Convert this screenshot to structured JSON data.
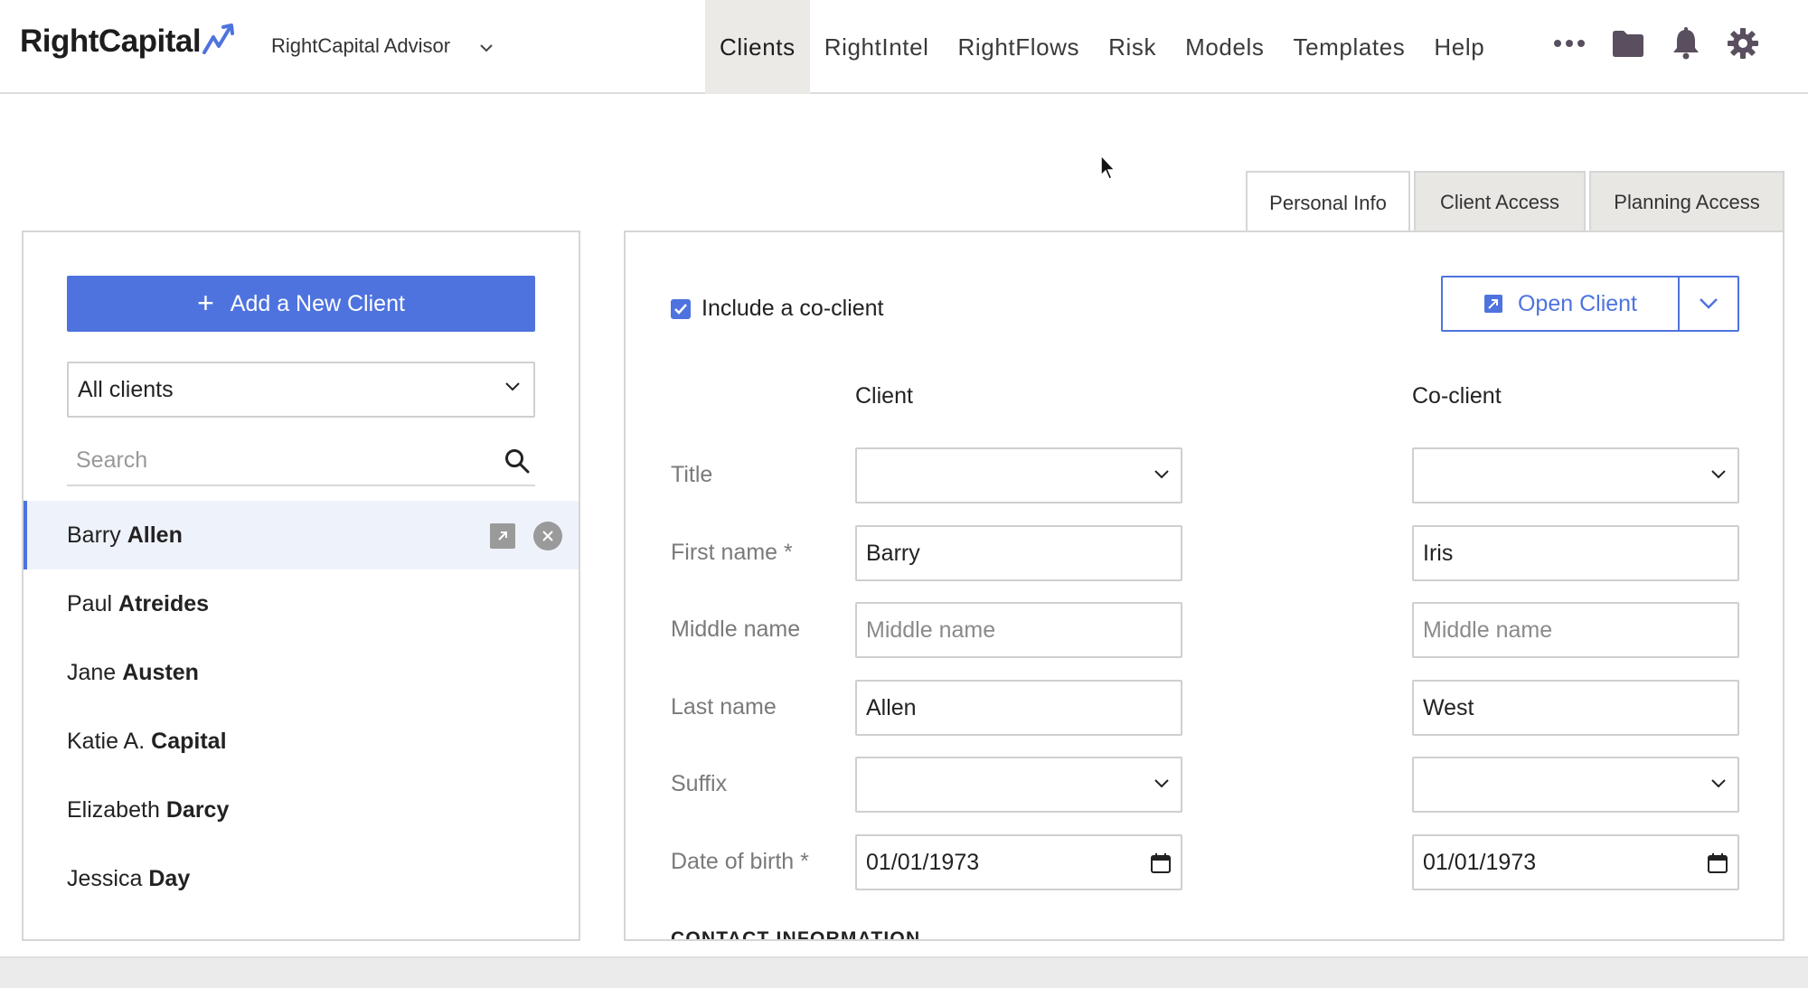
{
  "header": {
    "logo_text": "RightCapital",
    "advisor_label": "RightCapital Advisor",
    "nav": [
      {
        "label": "Clients",
        "active": true
      },
      {
        "label": "RightIntel",
        "active": false
      },
      {
        "label": "RightFlows",
        "active": false
      },
      {
        "label": "Risk",
        "active": false
      },
      {
        "label": "Models",
        "active": false
      },
      {
        "label": "Templates",
        "active": false
      },
      {
        "label": "Help",
        "active": false
      }
    ],
    "icons": [
      "more-dots-icon",
      "folder-icon",
      "bell-icon",
      "gear-icon"
    ]
  },
  "sidebar": {
    "add_button_label": "Add a New Client",
    "filter_value": "All clients",
    "search_placeholder": "Search",
    "clients": [
      {
        "first": "Barry",
        "last": "Allen",
        "selected": true
      },
      {
        "first": "Paul",
        "last": "Atreides",
        "selected": false
      },
      {
        "first": "Jane",
        "last": "Austen",
        "selected": false
      },
      {
        "first": "Katie A.",
        "last": "Capital",
        "selected": false
      },
      {
        "first": "Elizabeth",
        "last": "Darcy",
        "selected": false
      },
      {
        "first": "Jessica",
        "last": "Day",
        "selected": false
      }
    ]
  },
  "tabs": [
    {
      "label": "Personal Info",
      "active": true
    },
    {
      "label": "Client Access",
      "active": false
    },
    {
      "label": "Planning Access",
      "active": false
    }
  ],
  "form": {
    "include_coclient_label": "Include a co-client",
    "include_coclient_checked": true,
    "open_client_label": "Open Client",
    "client_header": "Client",
    "coclient_header": "Co-client",
    "labels": {
      "title": "Title",
      "first_name": "First name *",
      "middle_name": "Middle name",
      "last_name": "Last name",
      "suffix": "Suffix",
      "dob": "Date of birth *"
    },
    "client": {
      "title": "",
      "first_name": "Barry",
      "middle_name": "",
      "middle_placeholder": "Middle name",
      "last_name": "Allen",
      "suffix": "",
      "dob": "01/01/1973"
    },
    "coclient": {
      "title": "",
      "first_name": "Iris",
      "middle_name": "",
      "middle_placeholder": "Middle name",
      "last_name": "West",
      "suffix": "",
      "dob": "01/01/1973"
    },
    "section_heading": "CONTACT INFORMATION"
  },
  "colors": {
    "accent": "#4e73df",
    "nav_active_bg": "#eceae7",
    "selected_row_bg": "#eef2fb",
    "icon_dark": "#5a4f5e"
  }
}
